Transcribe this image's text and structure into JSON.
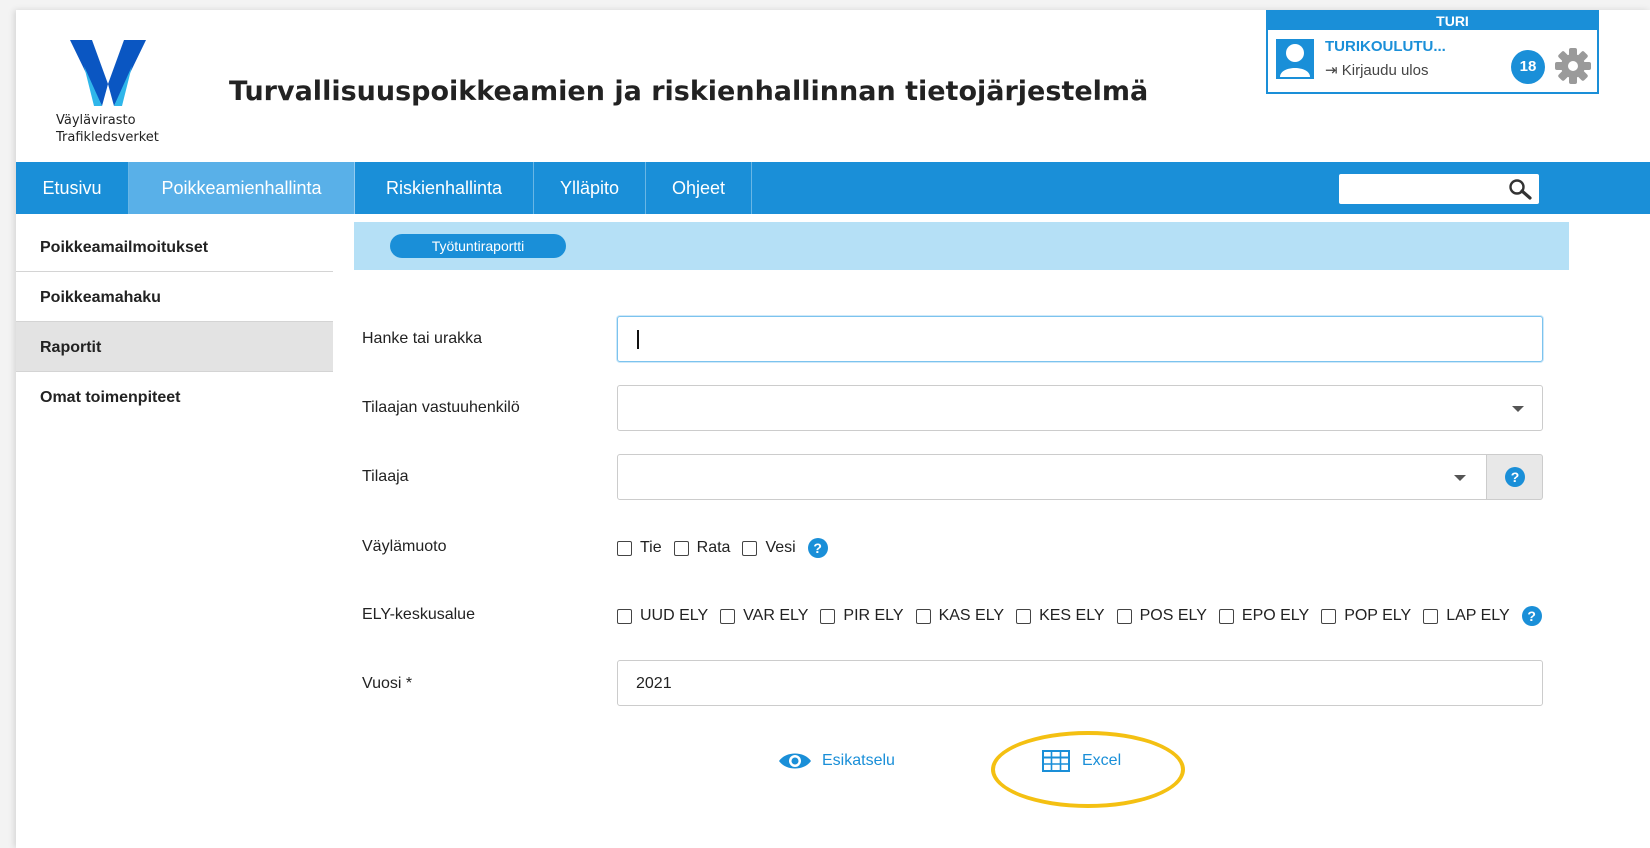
{
  "brand": {
    "line1": "Väylävirasto",
    "line2": "Trafikledsverket"
  },
  "app_title": "Turvallisuuspoikkeamien ja riskienhallinnan tietojärjestelmä",
  "user": {
    "system": "TURI",
    "name": "TURIKOULUTU...",
    "logout": "Kirjaudu ulos",
    "notification_count": "18"
  },
  "nav": {
    "items": [
      "Etusivu",
      "Poikkeamienhallinta",
      "Riskienhallinta",
      "Ylläpito",
      "Ohjeet"
    ],
    "active": "Poikkeamienhallinta",
    "search_value": ""
  },
  "sidebar": {
    "items": [
      "Poikkeamailmoitukset",
      "Poikkeamahaku",
      "Raportit",
      "Omat toimenpiteet"
    ],
    "active": "Raportit"
  },
  "tab": {
    "label": "Työtuntiraportti"
  },
  "form": {
    "project_label": "Hanke tai urakka",
    "project_value": "",
    "contact_label": "Tilaajan vastuuhenkilö",
    "contact_value": "",
    "client_label": "Tilaaja",
    "client_value": "",
    "mode_label": "Väylämuoto",
    "mode_options": [
      "Tie",
      "Rata",
      "Vesi"
    ],
    "ely_label": "ELY-keskusalue",
    "ely_options": [
      "UUD ELY",
      "VAR ELY",
      "PIR ELY",
      "KAS ELY",
      "KES ELY",
      "POS ELY",
      "EPO ELY",
      "POP ELY",
      "LAP ELY"
    ],
    "year_label": "Vuosi *",
    "year_value": "2021"
  },
  "actions": {
    "preview": "Esikatselu",
    "excel": "Excel"
  },
  "colors": {
    "primary": "#1a8fd8",
    "nav_active": "#59b0e8",
    "tab_strip": "#b5e0f6",
    "highlight": "#f4c012"
  }
}
